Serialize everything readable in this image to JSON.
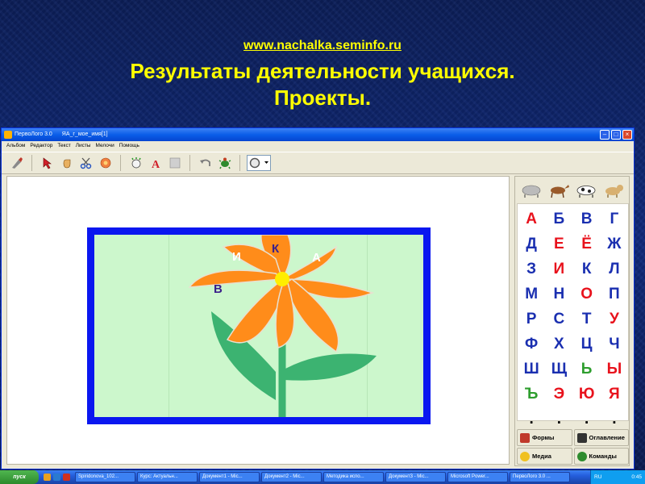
{
  "heading": {
    "link": "www.nachalka.seminfo.ru",
    "title_line1": "Результаты деятельности учащихся.",
    "title_line2": "Проекты."
  },
  "window": {
    "app_name": "ПервоЛого 3.0",
    "document": "ЯА_г_мое_имя[1]"
  },
  "menu": [
    "Альбом",
    "Редактор",
    "Текст",
    "Листы",
    "Мелочи",
    "Помощь"
  ],
  "toolbar_icons": [
    "brush-icon",
    "pointer-icon",
    "hand-icon",
    "scissors-icon",
    "stamp-icon",
    "turtle-new-icon",
    "text-icon",
    "shape-icon",
    "undo-icon",
    "turtle-icon",
    "color-icon"
  ],
  "flower": {
    "letters": [
      {
        "char": "К",
        "color": "#3a1f8a"
      },
      {
        "char": "И",
        "color": "#ffffff"
      },
      {
        "char": "А",
        "color": "#ffffff"
      },
      {
        "char": "В",
        "color": "#3a1f8a"
      }
    ],
    "petal_color": "#ff8c1a",
    "center_color": "#ffee00",
    "stem_color": "#3cb371",
    "frame_color": "#0a17f0",
    "background_color": "#ccf7cc"
  },
  "palette": {
    "animals": [
      "sheep-icon",
      "horse-icon",
      "cow-icon",
      "dog-icon"
    ],
    "letters": [
      {
        "char": "А",
        "color": "#e8121c"
      },
      {
        "char": "Б",
        "color": "#1a2fb0"
      },
      {
        "char": "В",
        "color": "#1a2fb0"
      },
      {
        "char": "Г",
        "color": "#1a2fb0"
      },
      {
        "char": "Д",
        "color": "#1a2fb0"
      },
      {
        "char": "Е",
        "color": "#e8121c"
      },
      {
        "char": "Ё",
        "color": "#e8121c"
      },
      {
        "char": "Ж",
        "color": "#1a2fb0"
      },
      {
        "char": "З",
        "color": "#1a2fb0"
      },
      {
        "char": "И",
        "color": "#e8121c"
      },
      {
        "char": "К",
        "color": "#1a2fb0"
      },
      {
        "char": "Л",
        "color": "#1a2fb0"
      },
      {
        "char": "М",
        "color": "#1a2fb0"
      },
      {
        "char": "Н",
        "color": "#1a2fb0"
      },
      {
        "char": "О",
        "color": "#e8121c"
      },
      {
        "char": "П",
        "color": "#1a2fb0"
      },
      {
        "char": "Р",
        "color": "#1a2fb0"
      },
      {
        "char": "С",
        "color": "#1a2fb0"
      },
      {
        "char": "Т",
        "color": "#1a2fb0"
      },
      {
        "char": "У",
        "color": "#e8121c"
      },
      {
        "char": "Ф",
        "color": "#1a2fb0"
      },
      {
        "char": "Х",
        "color": "#1a2fb0"
      },
      {
        "char": "Ц",
        "color": "#1a2fb0"
      },
      {
        "char": "Ч",
        "color": "#1a2fb0"
      },
      {
        "char": "Ш",
        "color": "#1a2fb0"
      },
      {
        "char": "Щ",
        "color": "#1a2fb0"
      },
      {
        "char": "Ь",
        "color": "#2e9e2e"
      },
      {
        "char": "Ы",
        "color": "#e8121c"
      },
      {
        "char": "Ъ",
        "color": "#2e9e2e"
      },
      {
        "char": "Э",
        "color": "#e8121c"
      },
      {
        "char": "Ю",
        "color": "#e8121c"
      },
      {
        "char": "Я",
        "color": "#e8121c"
      },
      {
        "char": ".",
        "color": "#000000"
      },
      {
        "char": ".",
        "color": "#000000"
      },
      {
        "char": ".",
        "color": "#000000"
      },
      {
        "char": ".",
        "color": "#000000"
      }
    ],
    "tabs": [
      {
        "label": "Формы",
        "icon": "shapes-icon"
      },
      {
        "label": "Оглавление",
        "icon": "contents-icon"
      },
      {
        "label": "Медиа",
        "icon": "media-icon"
      },
      {
        "label": "Команды",
        "icon": "commands-icon"
      }
    ]
  },
  "taskbar": {
    "start": "пуск",
    "tasks": [
      "Spiridonova_102...",
      "Курс: Актуальн...",
      "Документ1 - Mic...",
      "Документ2 - Mic...",
      "Методика испо...",
      "Документ3 - Mic...",
      "Microsoft Power...",
      "ПервоЛого 3.0 ..."
    ],
    "lang": "RU",
    "clock": "0:45"
  }
}
